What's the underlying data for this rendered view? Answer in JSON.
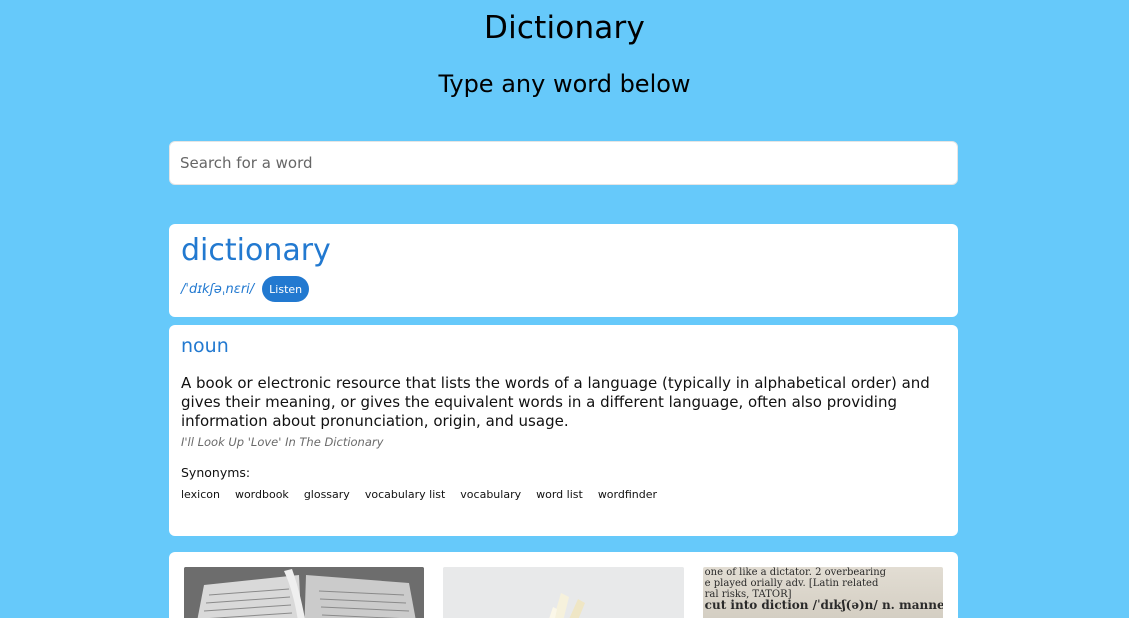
{
  "header": {
    "title": "Dictionary",
    "subtitle": "Type any word below"
  },
  "search": {
    "placeholder": "Search for a word",
    "value": ""
  },
  "result": {
    "word": "dictionary",
    "phonetic": "/ˈdɪkʃəˌnɛri/",
    "listen_label": "Listen"
  },
  "meaning": {
    "part_of_speech": "noun",
    "definition": "A book or electronic resource that lists the words of a language (typically in alphabetical order) and gives their meaning, or gives the equivalent words in a different language, often also providing information about pronunciation, origin, and usage.",
    "example": "I'll Look Up 'Love' In The Dictionary",
    "synonyms_label": "Synonyms:",
    "synonyms": [
      "lexicon",
      "wordbook",
      "glossary",
      "vocabulary list",
      "vocabulary",
      "word list",
      "wordfinder"
    ]
  },
  "images": {
    "thumb3_lines": [
      "one of   like a dictator. 2 overbearing",
      "e played   orially adv. [Latin related",
      "ral risks,   TATOR]",
      "cut into   diction /ˈdɪkʃ(ə)n/ n. manne"
    ]
  },
  "colors": {
    "background": "#66c9fa",
    "accent": "#2279d0",
    "card": "#ffffff"
  }
}
